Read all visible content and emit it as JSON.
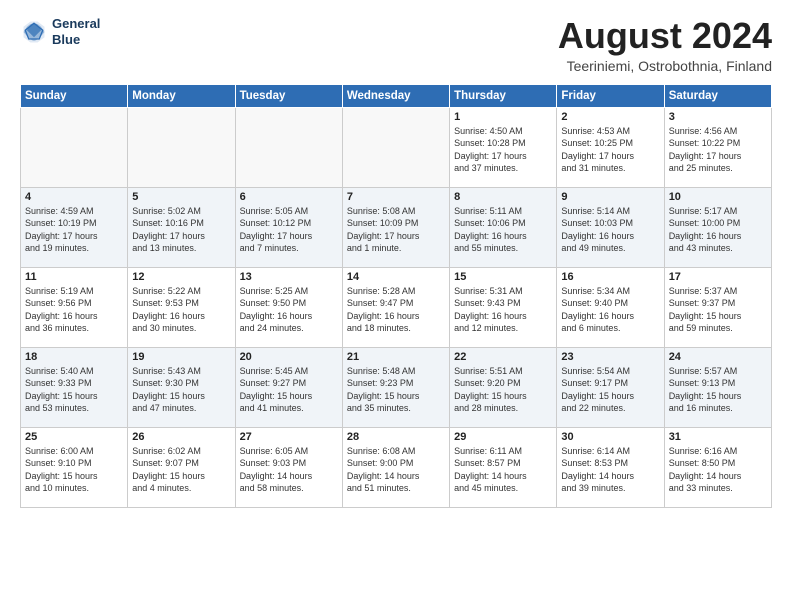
{
  "header": {
    "logo_line1": "General",
    "logo_line2": "Blue",
    "month_title": "August 2024",
    "subtitle": "Teeriniemi, Ostrobothnia, Finland"
  },
  "weekdays": [
    "Sunday",
    "Monday",
    "Tuesday",
    "Wednesday",
    "Thursday",
    "Friday",
    "Saturday"
  ],
  "weeks": [
    {
      "alt": false,
      "days": [
        {
          "num": "",
          "info": ""
        },
        {
          "num": "",
          "info": ""
        },
        {
          "num": "",
          "info": ""
        },
        {
          "num": "",
          "info": ""
        },
        {
          "num": "1",
          "info": "Sunrise: 4:50 AM\nSunset: 10:28 PM\nDaylight: 17 hours\nand 37 minutes."
        },
        {
          "num": "2",
          "info": "Sunrise: 4:53 AM\nSunset: 10:25 PM\nDaylight: 17 hours\nand 31 minutes."
        },
        {
          "num": "3",
          "info": "Sunrise: 4:56 AM\nSunset: 10:22 PM\nDaylight: 17 hours\nand 25 minutes."
        }
      ]
    },
    {
      "alt": true,
      "days": [
        {
          "num": "4",
          "info": "Sunrise: 4:59 AM\nSunset: 10:19 PM\nDaylight: 17 hours\nand 19 minutes."
        },
        {
          "num": "5",
          "info": "Sunrise: 5:02 AM\nSunset: 10:16 PM\nDaylight: 17 hours\nand 13 minutes."
        },
        {
          "num": "6",
          "info": "Sunrise: 5:05 AM\nSunset: 10:12 PM\nDaylight: 17 hours\nand 7 minutes."
        },
        {
          "num": "7",
          "info": "Sunrise: 5:08 AM\nSunset: 10:09 PM\nDaylight: 17 hours\nand 1 minute."
        },
        {
          "num": "8",
          "info": "Sunrise: 5:11 AM\nSunset: 10:06 PM\nDaylight: 16 hours\nand 55 minutes."
        },
        {
          "num": "9",
          "info": "Sunrise: 5:14 AM\nSunset: 10:03 PM\nDaylight: 16 hours\nand 49 minutes."
        },
        {
          "num": "10",
          "info": "Sunrise: 5:17 AM\nSunset: 10:00 PM\nDaylight: 16 hours\nand 43 minutes."
        }
      ]
    },
    {
      "alt": false,
      "days": [
        {
          "num": "11",
          "info": "Sunrise: 5:19 AM\nSunset: 9:56 PM\nDaylight: 16 hours\nand 36 minutes."
        },
        {
          "num": "12",
          "info": "Sunrise: 5:22 AM\nSunset: 9:53 PM\nDaylight: 16 hours\nand 30 minutes."
        },
        {
          "num": "13",
          "info": "Sunrise: 5:25 AM\nSunset: 9:50 PM\nDaylight: 16 hours\nand 24 minutes."
        },
        {
          "num": "14",
          "info": "Sunrise: 5:28 AM\nSunset: 9:47 PM\nDaylight: 16 hours\nand 18 minutes."
        },
        {
          "num": "15",
          "info": "Sunrise: 5:31 AM\nSunset: 9:43 PM\nDaylight: 16 hours\nand 12 minutes."
        },
        {
          "num": "16",
          "info": "Sunrise: 5:34 AM\nSunset: 9:40 PM\nDaylight: 16 hours\nand 6 minutes."
        },
        {
          "num": "17",
          "info": "Sunrise: 5:37 AM\nSunset: 9:37 PM\nDaylight: 15 hours\nand 59 minutes."
        }
      ]
    },
    {
      "alt": true,
      "days": [
        {
          "num": "18",
          "info": "Sunrise: 5:40 AM\nSunset: 9:33 PM\nDaylight: 15 hours\nand 53 minutes."
        },
        {
          "num": "19",
          "info": "Sunrise: 5:43 AM\nSunset: 9:30 PM\nDaylight: 15 hours\nand 47 minutes."
        },
        {
          "num": "20",
          "info": "Sunrise: 5:45 AM\nSunset: 9:27 PM\nDaylight: 15 hours\nand 41 minutes."
        },
        {
          "num": "21",
          "info": "Sunrise: 5:48 AM\nSunset: 9:23 PM\nDaylight: 15 hours\nand 35 minutes."
        },
        {
          "num": "22",
          "info": "Sunrise: 5:51 AM\nSunset: 9:20 PM\nDaylight: 15 hours\nand 28 minutes."
        },
        {
          "num": "23",
          "info": "Sunrise: 5:54 AM\nSunset: 9:17 PM\nDaylight: 15 hours\nand 22 minutes."
        },
        {
          "num": "24",
          "info": "Sunrise: 5:57 AM\nSunset: 9:13 PM\nDaylight: 15 hours\nand 16 minutes."
        }
      ]
    },
    {
      "alt": false,
      "days": [
        {
          "num": "25",
          "info": "Sunrise: 6:00 AM\nSunset: 9:10 PM\nDaylight: 15 hours\nand 10 minutes."
        },
        {
          "num": "26",
          "info": "Sunrise: 6:02 AM\nSunset: 9:07 PM\nDaylight: 15 hours\nand 4 minutes."
        },
        {
          "num": "27",
          "info": "Sunrise: 6:05 AM\nSunset: 9:03 PM\nDaylight: 14 hours\nand 58 minutes."
        },
        {
          "num": "28",
          "info": "Sunrise: 6:08 AM\nSunset: 9:00 PM\nDaylight: 14 hours\nand 51 minutes."
        },
        {
          "num": "29",
          "info": "Sunrise: 6:11 AM\nSunset: 8:57 PM\nDaylight: 14 hours\nand 45 minutes."
        },
        {
          "num": "30",
          "info": "Sunrise: 6:14 AM\nSunset: 8:53 PM\nDaylight: 14 hours\nand 39 minutes."
        },
        {
          "num": "31",
          "info": "Sunrise: 6:16 AM\nSunset: 8:50 PM\nDaylight: 14 hours\nand 33 minutes."
        }
      ]
    }
  ]
}
